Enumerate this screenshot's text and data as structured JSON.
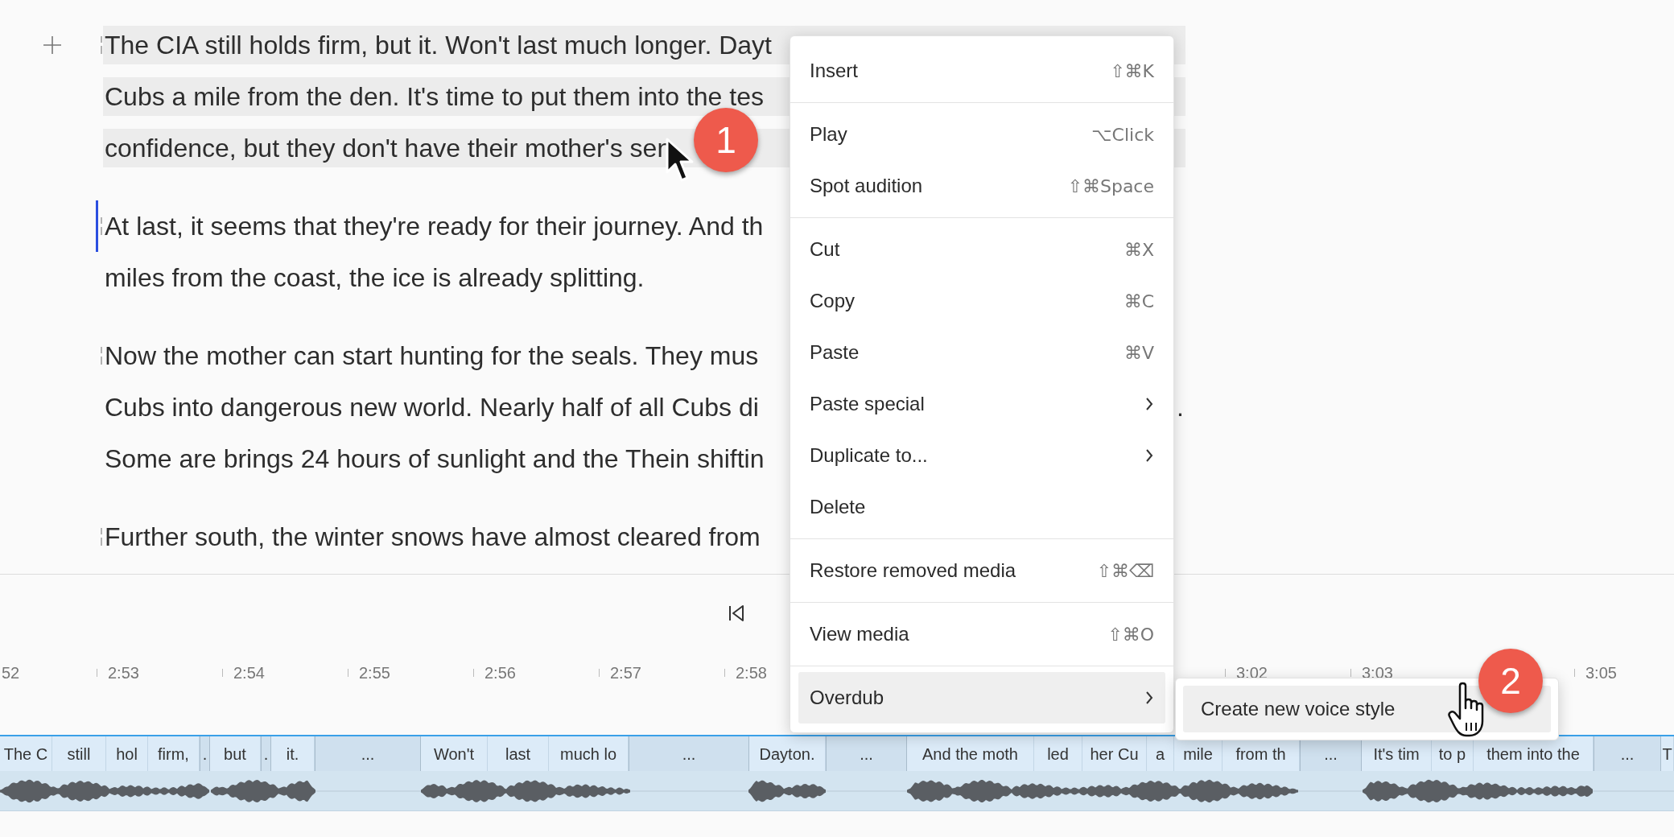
{
  "editor": {
    "paragraphs": [
      {
        "highlighted": true,
        "has_caret": false,
        "lines": [
          {
            "text": "The CIA still holds firm, but it. Won't last much longer. Dayt"
          },
          {
            "text": "Cubs a mile from the den. It's time to put them into the tes"
          },
          {
            "text": "confidence, but they don't have their mother's sen"
          }
        ]
      },
      {
        "highlighted": false,
        "has_caret": true,
        "lines": [
          {
            "text": "At last, it seems that they're ready for their journey. And th"
          },
          {
            "text": "miles from the coast, the ice is already splitting."
          }
        ]
      },
      {
        "highlighted": false,
        "has_caret": false,
        "lines": [
          {
            "text": "Now the mother can start hunting for the seals. They mus"
          },
          {
            "text": "Cubs into dangerous new world. Nearly half of all Cubs di",
            "tail": "."
          },
          {
            "text": "Some are brings 24 hours of sunlight and the Thein shiftin"
          }
        ]
      },
      {
        "highlighted": false,
        "has_caret": false,
        "lines": [
          {
            "text": "Further south, the winter snows have almost cleared from"
          }
        ]
      }
    ]
  },
  "ruler": {
    "ticks": [
      "52",
      "2:53",
      "2:54",
      "2:55",
      "2:56",
      "2:57",
      "2:58",
      "3:02",
      "3:03",
      "3:05"
    ]
  },
  "track": {
    "words": [
      {
        "text": "The C",
        "kind": "word"
      },
      {
        "text": "still",
        "kind": "word"
      },
      {
        "text": "hol",
        "kind": "word"
      },
      {
        "text": "firm,",
        "kind": "word"
      },
      {
        "text": ".",
        "kind": "pause"
      },
      {
        "text": "but",
        "kind": "word"
      },
      {
        "text": ".",
        "kind": "pause"
      },
      {
        "text": "it.",
        "kind": "word"
      },
      {
        "text": "...",
        "kind": "pause"
      },
      {
        "text": "Won't",
        "kind": "word"
      },
      {
        "text": "last",
        "kind": "word"
      },
      {
        "text": "much lo",
        "kind": "word"
      },
      {
        "text": "...",
        "kind": "pause"
      },
      {
        "text": "Dayton.",
        "kind": "word"
      },
      {
        "text": "...",
        "kind": "pause"
      },
      {
        "text": "And the moth",
        "kind": "word"
      },
      {
        "text": "led",
        "kind": "word"
      },
      {
        "text": "her Cu",
        "kind": "word"
      },
      {
        "text": "a",
        "kind": "word"
      },
      {
        "text": "mile",
        "kind": "word"
      },
      {
        "text": "from th",
        "kind": "word"
      },
      {
        "text": "...",
        "kind": "pause"
      },
      {
        "text": "It's tim",
        "kind": "word"
      },
      {
        "text": "to p",
        "kind": "word"
      },
      {
        "text": "them into the",
        "kind": "word"
      },
      {
        "text": "...",
        "kind": "pause"
      },
      {
        "text": "T",
        "kind": "word"
      }
    ]
  },
  "context_menu": {
    "sections": [
      [
        {
          "label": "Insert",
          "shortcut": "⇧⌘K",
          "submenu": false,
          "highlighted": false
        }
      ],
      [
        {
          "label": "Play",
          "shortcut": "⌥Click",
          "submenu": false,
          "highlighted": false
        },
        {
          "label": "Spot audition",
          "shortcut": "⇧⌘Space",
          "submenu": false,
          "highlighted": false
        }
      ],
      [
        {
          "label": "Cut",
          "shortcut": "⌘X",
          "submenu": false,
          "highlighted": false
        },
        {
          "label": "Copy",
          "shortcut": "⌘C",
          "submenu": false,
          "highlighted": false
        },
        {
          "label": "Paste",
          "shortcut": "⌘V",
          "submenu": false,
          "highlighted": false
        },
        {
          "label": "Paste special",
          "submenu": true,
          "highlighted": false
        },
        {
          "label": "Duplicate to...",
          "submenu": true,
          "highlighted": false
        },
        {
          "label": "Delete",
          "submenu": false,
          "highlighted": false
        }
      ],
      [
        {
          "label": "Restore removed media",
          "shortcut": "⇧⌘⌫",
          "submenu": false,
          "highlighted": false
        }
      ],
      [
        {
          "label": "View media",
          "shortcut": "⇧⌘O",
          "submenu": false,
          "highlighted": false
        }
      ],
      [
        {
          "label": "Overdub",
          "submenu": true,
          "highlighted": true
        }
      ]
    ]
  },
  "submenu": {
    "items": [
      {
        "label": "Create new voice style",
        "highlighted": true
      }
    ]
  },
  "callouts": [
    "1",
    "2"
  ]
}
